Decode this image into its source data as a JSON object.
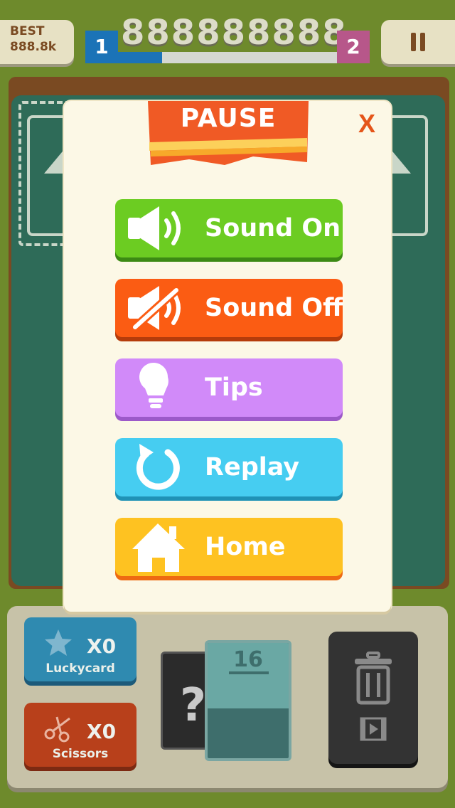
{
  "hud": {
    "best_label": "BEST",
    "best_value": "888.8k",
    "score": "888888888",
    "level_current": "1",
    "level_next": "2",
    "level_progress": 0.2
  },
  "pause_dialog": {
    "title": "PAUSE",
    "close_label": "X",
    "buttons": [
      {
        "label": "Sound On",
        "icon": "speaker-on-icon",
        "color": "#6ccc22"
      },
      {
        "label": "Sound Off",
        "icon": "speaker-muted-icon",
        "color": "#fb5c13"
      },
      {
        "label": "Tips",
        "icon": "lightbulb-icon",
        "color": "#d18af9"
      },
      {
        "label": "Replay",
        "icon": "replay-icon",
        "color": "#46cdf1"
      },
      {
        "label": "Home",
        "icon": "home-icon",
        "color": "#fec221"
      }
    ]
  },
  "tray": {
    "luckycard": {
      "count": "X0",
      "label": "Luckycard",
      "icon": "star-icon"
    },
    "scissors": {
      "count": "X0",
      "label": "Scissors",
      "icon": "scissors-icon"
    },
    "mystery_card": "?",
    "next_card_value": "16",
    "trash": {
      "icon": "trash-icon",
      "video_icon": "video-icon"
    }
  }
}
